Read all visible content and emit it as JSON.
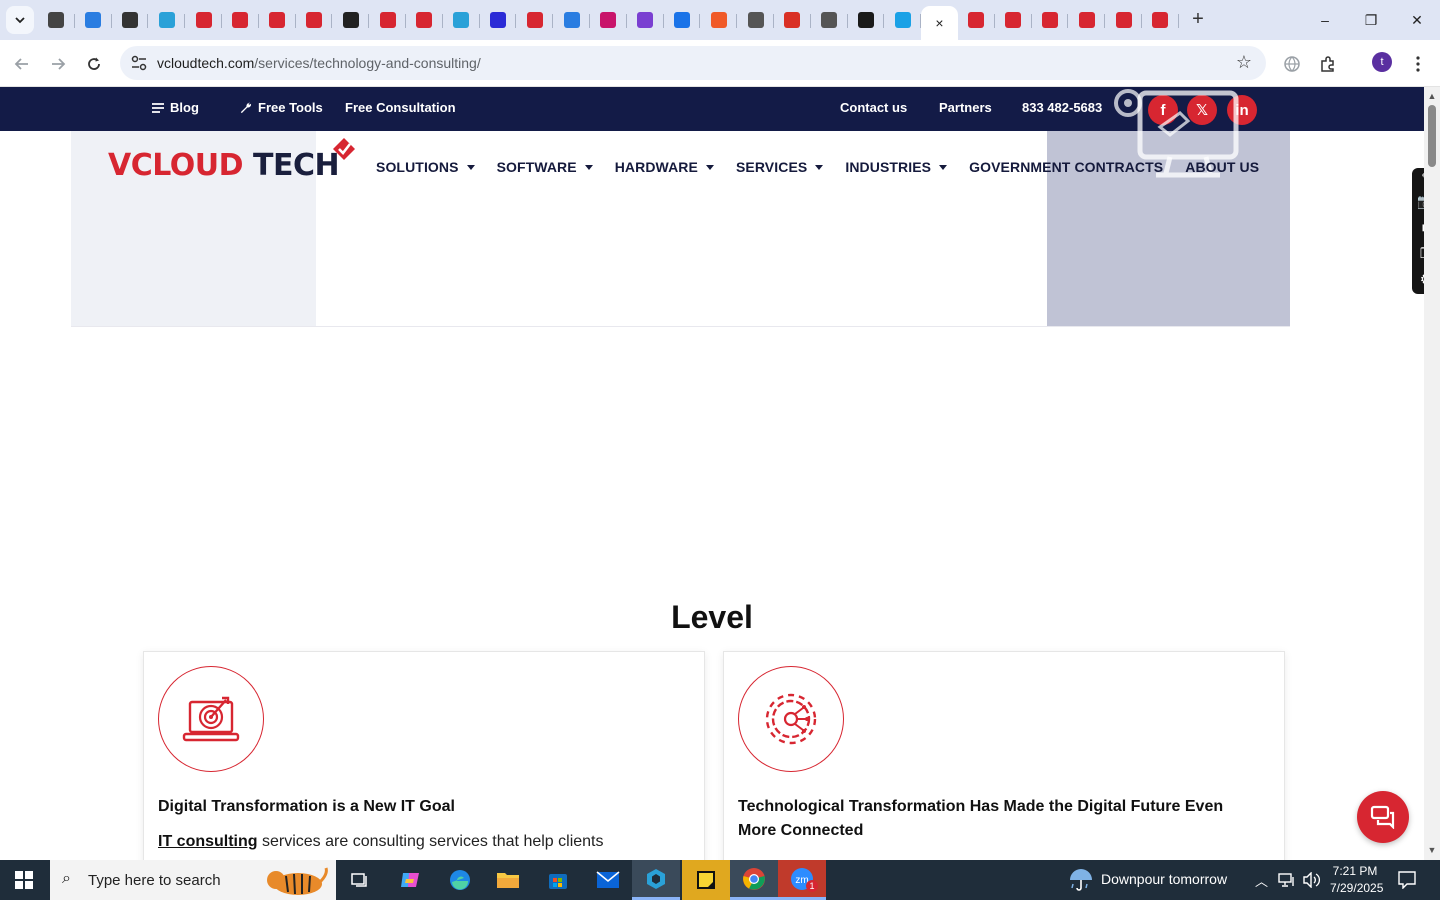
{
  "browser": {
    "tab_count_before_active": 24,
    "favicons": [
      "#444",
      "#2a7de1",
      "#333",
      "#2aa1d8",
      "#d72631",
      "#d72631",
      "#d72631",
      "#d72631",
      "#222",
      "#d72631",
      "#d72631",
      "#2aa1d8",
      "#2b2bd6",
      "#d72631",
      "#2a7de1",
      "#c8146a",
      "#7a3fd1",
      "#1a73e8",
      "#f05a28",
      "#555",
      "#d93025",
      "#555",
      "#1a1a1a",
      "#1aa1e6"
    ],
    "after_tabs": [
      "#d72631",
      "#d72631",
      "#d72631",
      "#d72631",
      "#d72631",
      "#d72631"
    ],
    "active_tab_close": "×",
    "new_tab": "+",
    "window_controls": [
      "–",
      "❐",
      "✕"
    ],
    "url_domain": "vcloudtech.com",
    "url_path": "/services/technology-and-consulting/",
    "profile_initial": "t"
  },
  "site": {
    "topbar_left": [
      {
        "icon": "list-icon",
        "label": "Blog"
      },
      {
        "icon": "wrench-icon",
        "label": "Free Tools"
      },
      {
        "icon": "",
        "label": "Free Consultation"
      }
    ],
    "topbar_right": [
      "Contact us",
      "Partners",
      "833 482-5683"
    ],
    "social": [
      "f",
      "𝕏",
      "in"
    ],
    "logo_v": "V",
    "logo_cloud": "CLOUD",
    "logo_tech": " TECH",
    "nav": [
      {
        "label": "SOLUTIONS",
        "caret": true
      },
      {
        "label": "SOFTWARE",
        "caret": true
      },
      {
        "label": "HARDWARE",
        "caret": true
      },
      {
        "label": "SERVICES",
        "caret": true
      },
      {
        "label": "INDUSTRIES",
        "caret": true
      },
      {
        "label": "GOVERNMENT CONTRACTS",
        "caret": false
      },
      {
        "label": "ABOUT US",
        "caret": false
      }
    ],
    "section_title": "Level",
    "cards": [
      {
        "icon": "target-laptop-icon",
        "title": "Digital Transformation is a New IT Goal",
        "link": "IT consulting",
        "text": " services are consulting services that help clients"
      },
      {
        "icon": "gear-network-icon",
        "title": "Technological Transformation Has Made the Digital Future Even More Connected",
        "link": "",
        "text": ""
      }
    ]
  },
  "side_widget": [
    "✎",
    "📷",
    "■",
    "❐",
    "⚙"
  ],
  "taskbar": {
    "search_placeholder": "Type here to search",
    "weather": "Downpour tomorrow",
    "time": "7:21 PM",
    "date": "7/29/2025",
    "zoom_badge": "1"
  },
  "colors": {
    "brand_red": "#d72631",
    "brand_navy": "#131b47",
    "tab_strip": "#dfe5f4"
  }
}
